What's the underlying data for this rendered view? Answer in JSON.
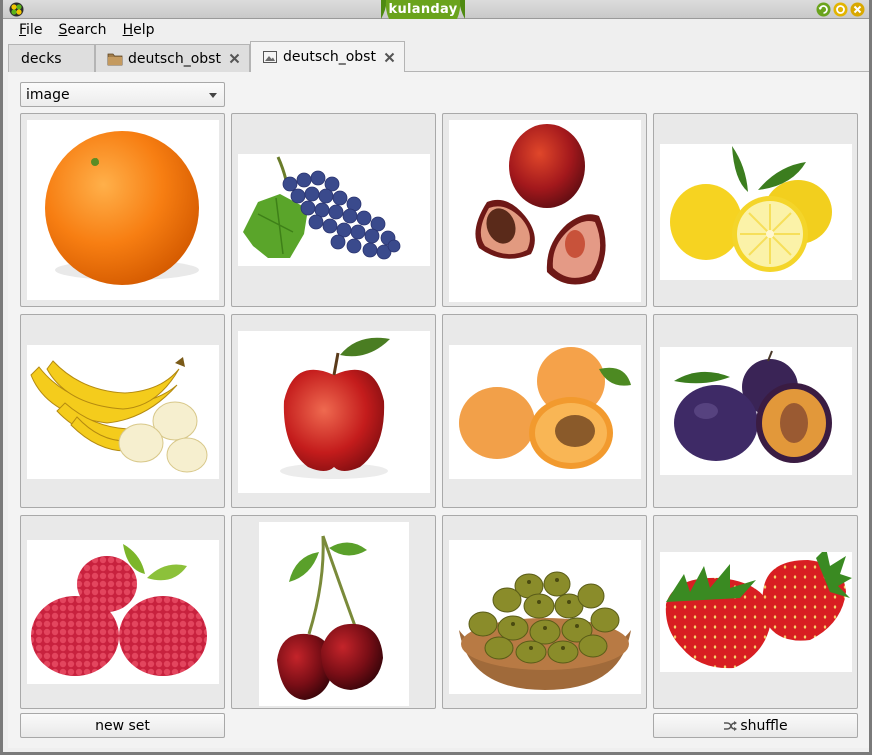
{
  "window": {
    "title": "kulanday",
    "icons": {
      "app": "app-logo-icon",
      "minimize": "minimize-icon",
      "maximize": "maximize-icon",
      "close": "close-icon"
    }
  },
  "menu": {
    "file": {
      "mnemonic": "F",
      "rest": "ile"
    },
    "search": {
      "mnemonic": "S",
      "rest": "earch"
    },
    "help": {
      "mnemonic": "H",
      "rest": "elp"
    }
  },
  "tabs": [
    {
      "label": "decks",
      "icon": null
    },
    {
      "label": "deutsch_obst",
      "icon": "folder-icon"
    },
    {
      "label": "deutsch_obst",
      "icon": "image-view-icon",
      "active": true
    }
  ],
  "view_select": {
    "value": "image"
  },
  "cards": [
    {
      "fruit": "orange"
    },
    {
      "fruit": "grapes"
    },
    {
      "fruit": "nectarine"
    },
    {
      "fruit": "lemon"
    },
    {
      "fruit": "banana"
    },
    {
      "fruit": "apple"
    },
    {
      "fruit": "apricot"
    },
    {
      "fruit": "plum"
    },
    {
      "fruit": "raspberry"
    },
    {
      "fruit": "cherry"
    },
    {
      "fruit": "olives"
    },
    {
      "fruit": "strawberry"
    }
  ],
  "buttons": {
    "new_set": "new set",
    "shuffle": "shuffle"
  },
  "colors": {
    "title_badge": "#6aa31c",
    "window_bg": "#efefef"
  }
}
